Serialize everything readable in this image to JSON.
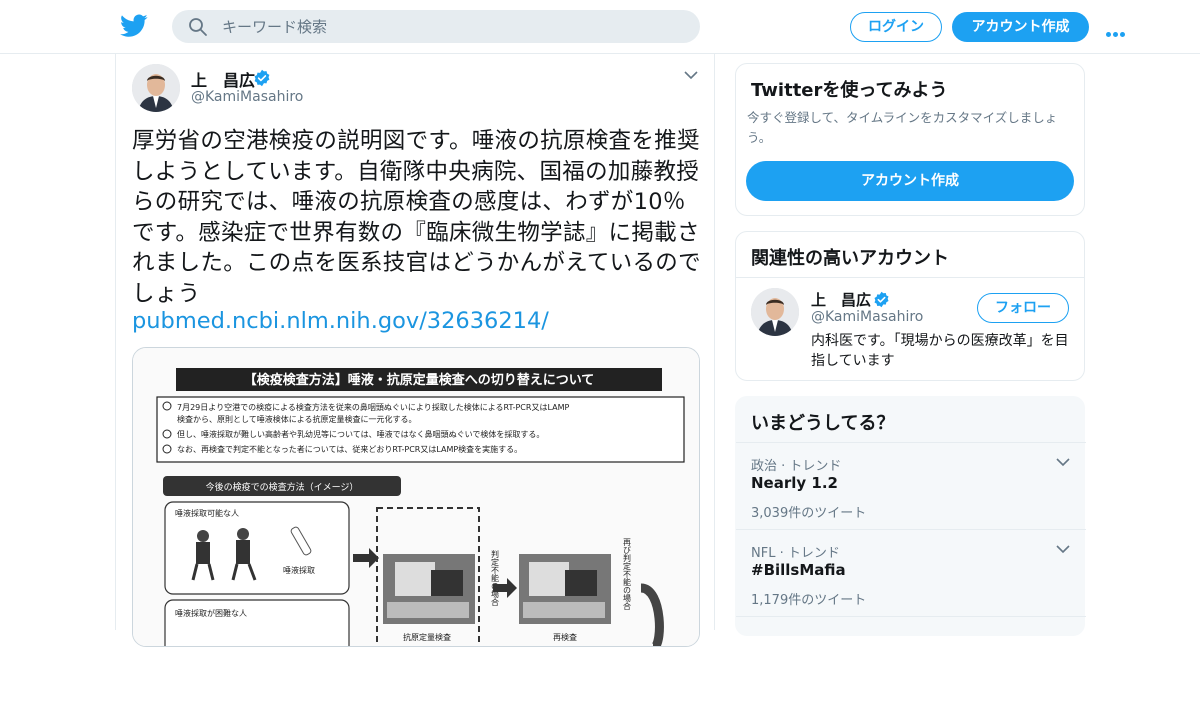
{
  "header": {
    "search_placeholder": "キーワード検索",
    "login_label": "ログイン",
    "signup_label": "アカウント作成"
  },
  "tweet": {
    "author_name": "上　昌広",
    "author_handle": "@KamiMasahiro",
    "text": "厚労省の空港検疫の説明図です。唾液の抗原検査を推奨しようとしています。自衛隊中央病院、国福の加藤教授らの研究では、唾液の抗原検査の感度は、わずが10％です。感染症で世界有数の『臨床微生物学誌』に掲載されました。この点を医系技官はどうかんがえているのでしょう",
    "link": "pubmed.ncbi.nlm.nih.gov/32636214/",
    "media": {
      "doc_title": "【検疫検査方法】唾液・抗原定量検査への切り替えについて",
      "bullet1_line1": "7月29日より空港での検疫による検査方法を従来の鼻咽頭ぬぐいにより採取した検体によるRT-PCR又はLAMP",
      "bullet1_line2": "検査から、原則として唾液検体による抗原定量検査に一元化する。",
      "bullet2": "但し、唾液採取が難しい高齢者や乳幼児等については、唾液ではなく鼻咽頭ぬぐいで検体を採取する。",
      "bullet3": "なお、再検査で判定不能となった者については、従来どおりRT-PCR又はLAMP検査を実施する。",
      "section_label": "今後の検疫での検査方法（イメージ）",
      "box1_title": "唾液採取可能な人",
      "box1_caption": "唾液採取",
      "box2_title": "唾液採取が困難な人",
      "side_label1": "判定不能の場合",
      "side_label2": "再び判定不能の場合",
      "bottom_label1": "抗原定量検査",
      "bottom_label2": "再検査"
    }
  },
  "sidebar": {
    "try_title": "Twitterを使ってみよう",
    "try_desc": "今すぐ登録して、タイムラインをカスタマイズしましょう。",
    "try_button": "アカウント作成",
    "related_title": "関連性の高いアカウント",
    "related": {
      "name": "上　昌広",
      "handle": "@KamiMasahiro",
      "follow_label": "フォロー",
      "bio": "内科医です。「現場からの医療改革」を目指しています"
    },
    "trends_title": "いまどうしてる？",
    "trends": [
      {
        "category": "政治 · トレンド",
        "name": "Nearly 1.2",
        "count": "3,039件のツイート"
      },
      {
        "category": "NFL · トレンド",
        "name": "#BillsMafia",
        "count": "1,179件のツイート"
      }
    ]
  },
  "colors": {
    "accent": "#1da1f2",
    "link": "#1b95e0",
    "muted": "#657786"
  }
}
